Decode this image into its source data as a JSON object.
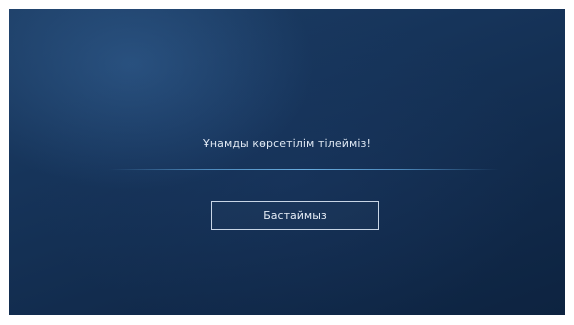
{
  "welcome": {
    "message": "Ұнамды көрсетілім тілейміз!",
    "start_button_label": "Бастаймыз"
  }
}
